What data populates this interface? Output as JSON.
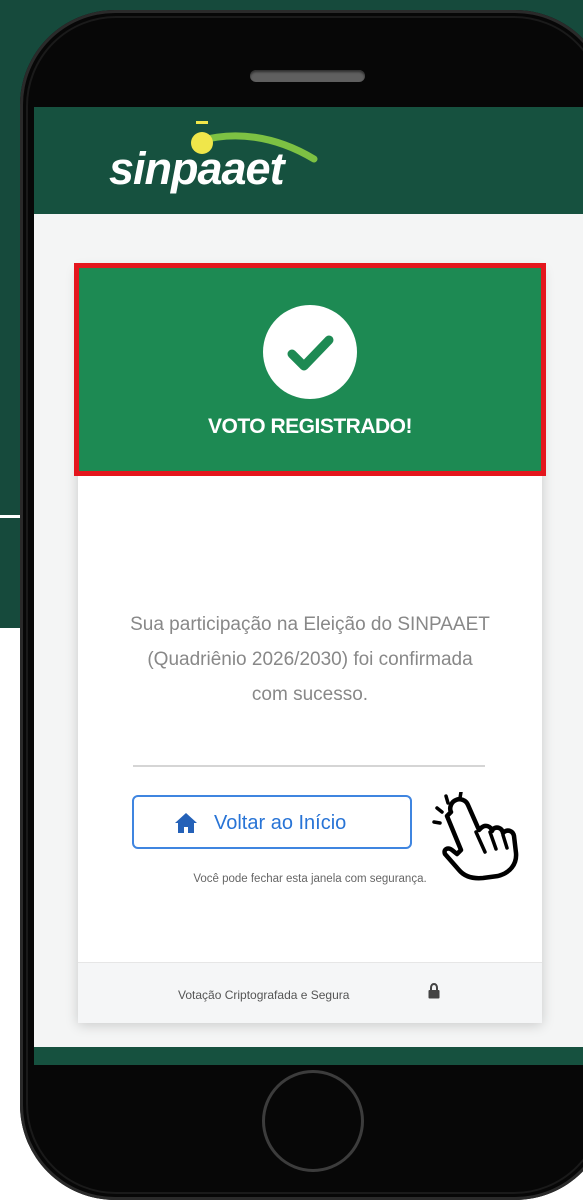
{
  "brand": {
    "logo_text": "sinpaaet",
    "primary_color": "#16513f",
    "success_color": "#1d8a53",
    "highlight_color": "#e4161d",
    "link_color": "#2874d6"
  },
  "background": {
    "colon": ":"
  },
  "confirmation": {
    "icon": "check-circle-icon",
    "title": "VOTO REGISTRADO!",
    "message": "Sua participação na Eleição do SINPAAET (Quadriênio 2026/2030) foi confirmada com sucesso.",
    "back_button_icon": "home-icon",
    "back_button_label": "Voltar ao Início",
    "safe_close_note": "Você pode fechar esta janela com segurança."
  },
  "pointer": {
    "icon": "pointing-hand-icon"
  },
  "footer": {
    "text": "Votação Criptografada e Segura",
    "icon": "lock-icon"
  }
}
